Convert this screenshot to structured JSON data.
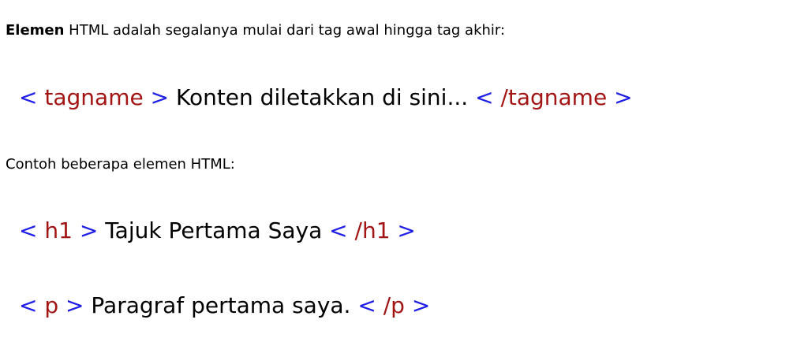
{
  "intro": {
    "bold": "Elemen",
    "rest": " HTML adalah segalanya mulai dari tag awal hingga tag akhir:"
  },
  "example_syntax": {
    "open_lt": "< ",
    "open_tag": "tagname",
    "open_gt": " >",
    "content": " Konten diletakkan di sini... ",
    "close_lt": "< ",
    "close_tag": "/tagname",
    "close_gt": " >"
  },
  "subhead": "Contoh beberapa elemen HTML:",
  "examples": [
    {
      "open_lt": "< ",
      "open_tag": "h1",
      "open_gt": " >",
      "content": " Tajuk Pertama Saya ",
      "close_lt": "< ",
      "close_tag": "/h1",
      "close_gt": " >"
    },
    {
      "open_lt": "< ",
      "open_tag": "p",
      "open_gt": " >",
      "content": " Paragraf pertama saya. ",
      "close_lt": "< ",
      "close_tag": "/p",
      "close_gt": " >"
    }
  ],
  "colors": {
    "bracket": "#1f1fe6",
    "tag_name": "#a31515",
    "text": "#000000"
  }
}
